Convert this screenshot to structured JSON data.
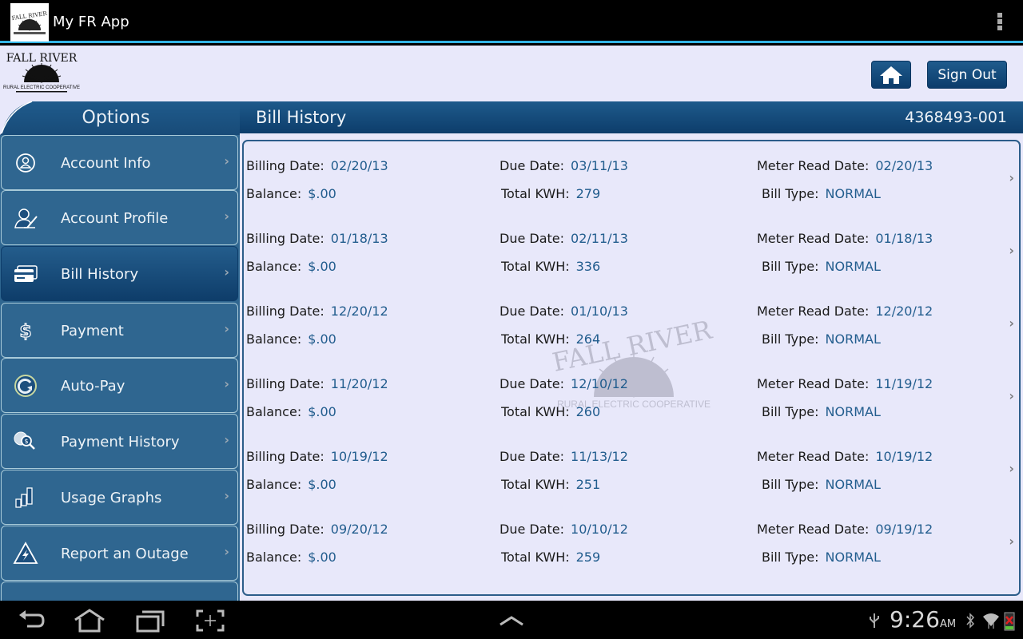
{
  "actionbar": {
    "app_title": "My FR App",
    "menu_icon": "overflow-menu-icon"
  },
  "header": {
    "logo_text_top": "FALL RIVER",
    "logo_text_bottom": "RURAL ELECTRIC COOPERATIVE",
    "home_button_icon": "home-icon",
    "signout_label": "Sign Out"
  },
  "sidebar": {
    "title": "Options",
    "items": [
      {
        "label": "Account Info",
        "icon": "account-info-icon",
        "active": false
      },
      {
        "label": "Account Profile",
        "icon": "account-profile-icon",
        "active": false
      },
      {
        "label": "Bill History",
        "icon": "bill-history-icon",
        "active": true
      },
      {
        "label": "Payment",
        "icon": "payment-icon",
        "active": false
      },
      {
        "label": "Auto-Pay",
        "icon": "auto-pay-icon",
        "active": false
      },
      {
        "label": "Payment History",
        "icon": "payment-history-icon",
        "active": false
      },
      {
        "label": "Usage Graphs",
        "icon": "usage-graphs-icon",
        "active": false
      },
      {
        "label": "Report an Outage",
        "icon": "outage-icon",
        "active": false
      }
    ]
  },
  "main": {
    "title": "Bill History",
    "account_number": "4368493-001",
    "labels": {
      "billing_date": "Billing Date:",
      "due_date": "Due Date:",
      "meter_read_date": "Meter Read Date:",
      "balance": "Balance:",
      "total_kwh": "Total KWH:",
      "bill_type": "Bill Type:"
    },
    "bills": [
      {
        "billing_date": "02/20/13",
        "due_date": "03/11/13",
        "meter_read_date": "02/20/13",
        "balance": "$.00",
        "total_kwh": "279",
        "bill_type": "NORMAL"
      },
      {
        "billing_date": "01/18/13",
        "due_date": "02/11/13",
        "meter_read_date": "01/18/13",
        "balance": "$.00",
        "total_kwh": "336",
        "bill_type": "NORMAL"
      },
      {
        "billing_date": "12/20/12",
        "due_date": "01/10/13",
        "meter_read_date": "12/20/12",
        "balance": "$.00",
        "total_kwh": "264",
        "bill_type": "NORMAL"
      },
      {
        "billing_date": "11/20/12",
        "due_date": "12/10/12",
        "meter_read_date": "11/19/12",
        "balance": "$.00",
        "total_kwh": "260",
        "bill_type": "NORMAL"
      },
      {
        "billing_date": "10/19/12",
        "due_date": "11/13/12",
        "meter_read_date": "10/19/12",
        "balance": "$.00",
        "total_kwh": "251",
        "bill_type": "NORMAL"
      },
      {
        "billing_date": "09/20/12",
        "due_date": "10/10/12",
        "meter_read_date": "09/19/12",
        "balance": "$.00",
        "total_kwh": "259",
        "bill_type": "NORMAL"
      }
    ]
  },
  "navbar": {
    "buttons": [
      "back-icon",
      "home-icon",
      "recent-apps-icon",
      "screenshot-icon",
      "expand-icon"
    ],
    "time": "9:26",
    "ampm": "AM",
    "status_icons": [
      "usb-icon",
      "bluetooth-icon",
      "wifi-icon",
      "battery-icon"
    ]
  },
  "colors": {
    "accent": "#33b5e5",
    "header_blue": "#0d3d6b",
    "sidebar_blue": "#2f6690",
    "value_blue": "#225d8e",
    "panel_bg": "#e8e8fa"
  }
}
